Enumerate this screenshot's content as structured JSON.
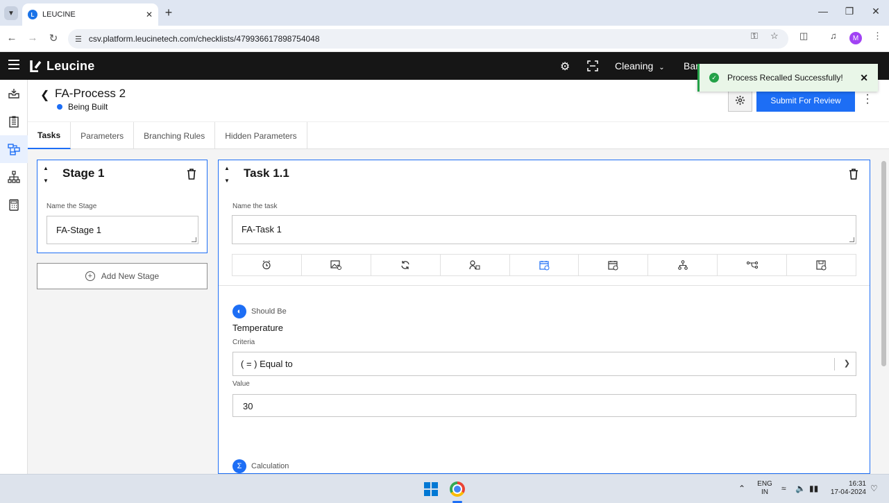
{
  "browser": {
    "tab_title": "LEUCINE",
    "url": "csv.platform.leucinetech.com/checklists/479936617898754048",
    "profile_initial": "M"
  },
  "appbar": {
    "brand": "Leucine",
    "facility": "Cleaning",
    "user_fragment": "Bar"
  },
  "toast": {
    "message": "Process Recalled Successfully!"
  },
  "process": {
    "title": "FA-Process 2",
    "status": "Being Built",
    "submit_label": "Submit For Review"
  },
  "tabs": [
    {
      "label": "Tasks"
    },
    {
      "label": "Parameters"
    },
    {
      "label": "Branching Rules"
    },
    {
      "label": "Hidden Parameters"
    }
  ],
  "stage": {
    "title": "Stage 1",
    "name_label": "Name the Stage",
    "name_value": "FA-Stage 1",
    "add_label": "Add New Stage"
  },
  "task": {
    "title": "Task 1.1",
    "name_label": "Name the task",
    "name_value": "FA-Task 1",
    "toolbar_icons": [
      "alarm-icon",
      "image-icon",
      "recurrence-icon",
      "assignee-icon",
      "schedule-icon",
      "due-date-icon",
      "hierarchy-icon",
      "branch-icon",
      "save-form-icon"
    ]
  },
  "parameter_1": {
    "type": "Should Be",
    "name": "Temperature",
    "criteria_label": "Criteria",
    "criteria_value": "( = ) Equal to",
    "value_label": "Value",
    "value": "30"
  },
  "parameter_2": {
    "type": "Calculation"
  },
  "taskbar": {
    "lang_top": "ENG",
    "lang_bottom": "IN",
    "time": "16:31",
    "date": "17-04-2024"
  }
}
